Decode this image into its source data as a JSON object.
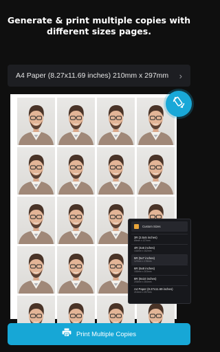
{
  "headline": {
    "line1": "Generate & print multiple copies with",
    "line2": "different sizes pages."
  },
  "paper_selector": {
    "label": "A4 Paper (8.27x11.69 inches) 210mm x 297mm",
    "chevron": "chevron-right-icon"
  },
  "preview": {
    "columns": 4,
    "rows": 5,
    "photo_count": 20,
    "rotate_icon": "rotate-icon",
    "accent": "#17a7d6"
  },
  "sizes_panel": {
    "title": "Custom Sizes",
    "items": [
      {
        "name": "3R (3.5x5 inches)",
        "dims": "89mm x 127mm"
      },
      {
        "name": "4R (4x6 inches)",
        "dims": "102mm x 152mm"
      },
      {
        "name": "5R (5x7 inches)",
        "dims": "127mm x 178mm"
      },
      {
        "name": "6R (6x8 inches)",
        "dims": "152mm x 203mm"
      },
      {
        "name": "8R (8x10 inches)",
        "dims": "203mm x 254mm"
      },
      {
        "name": "A4 Paper (8.27x11.69 inches)",
        "dims": "210mm x 297mm"
      }
    ],
    "selected_index": 2
  },
  "print_button": {
    "label": "Print Multiple Copies",
    "icon": "printer-icon"
  }
}
